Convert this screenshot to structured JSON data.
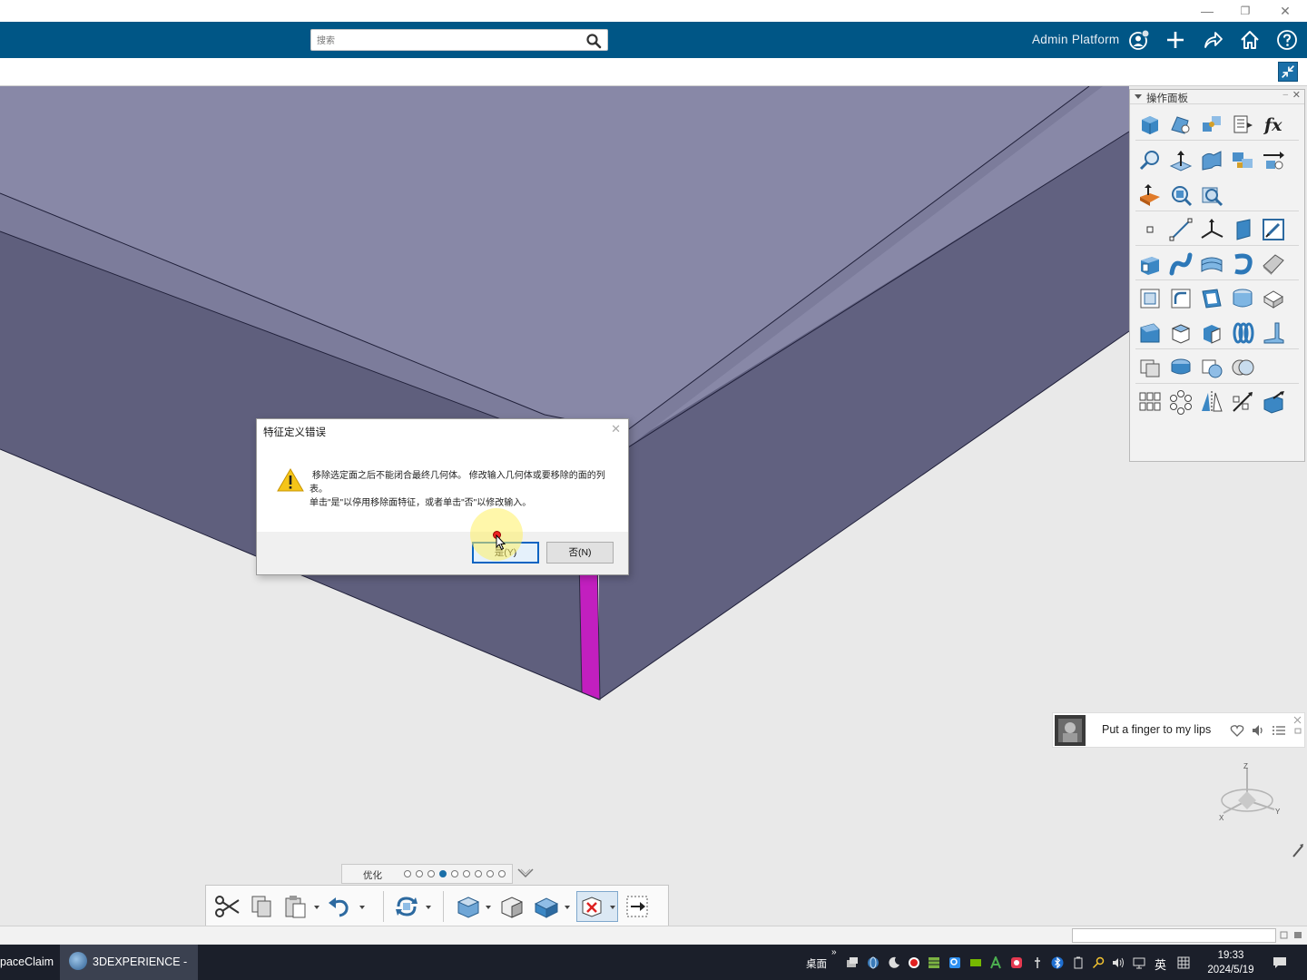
{
  "window": {
    "minimize_glyph": "—",
    "restore_glyph": "❐",
    "close_glyph": "✕"
  },
  "topbar": {
    "search_placeholder": "搜索",
    "platform_label": "Admin Platform",
    "bar_color": "#005686"
  },
  "ops_panel": {
    "title": "操作面板",
    "pin_glyph": "–",
    "close_glyph": "✕"
  },
  "dialog": {
    "title": "特征定义错误",
    "close_glyph": "✕",
    "message_line1": "移除选定面之后不能闭合最终几何体。 修改输入几何体或要移除的面的列表。",
    "message_line2": "单击\"是\"以停用移除面特征，或者单击\"否\"以修改输入。",
    "yes_label": "是(Y)",
    "no_label": "否(N)"
  },
  "music": {
    "song": "Put a finger to my lips"
  },
  "compass": {
    "z": "Z",
    "x": "X",
    "y": "Y"
  },
  "pager": {
    "label": "优化",
    "pages": [
      0,
      0,
      0,
      1,
      0,
      0,
      0,
      0,
      0
    ]
  },
  "taskbar": {
    "items": [
      {
        "label": "paceClaim",
        "active": false
      },
      {
        "label": "3DEXPERIENCE - [...",
        "active": true
      }
    ],
    "desktop_label": "桌面",
    "ime_label": "英",
    "time": "19:33",
    "date": "2024/5/19"
  },
  "colors": {
    "part_top": "#8a8aa8",
    "part_side": "#5e5e7a",
    "highlight_face": "#c41fc0",
    "accent": "#0a64c2"
  }
}
